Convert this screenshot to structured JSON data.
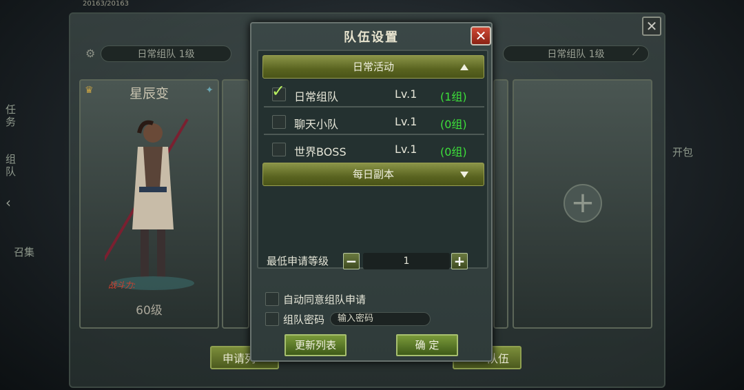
{
  "background": {
    "hp_text": "20163/20163",
    "left_chip": "日常组队 1级",
    "right_chip": "日常组队 1级",
    "hero_card": {
      "title": "星辰变",
      "level": "60级",
      "power_label": "战斗力:"
    },
    "side_left": [
      "任务",
      "组队",
      "召集"
    ],
    "side_right": [
      "开包"
    ],
    "bottom_left_btn": "申请列",
    "bottom_right_btn": "队伍",
    "icons": [
      "gear-icon",
      "crown-icon",
      "close-icon",
      "plus-icon",
      "brush-icon"
    ]
  },
  "dialog": {
    "title": "队伍设置",
    "close_icon": "close-icon",
    "categories": [
      {
        "label": "日常活动",
        "state": "expanded"
      },
      {
        "label": "每日副本",
        "state": "collapsed"
      }
    ],
    "rows": [
      {
        "name": "日常组队",
        "level": "Lv.1",
        "groups": "(1组)",
        "checked": true
      },
      {
        "name": "聊天小队",
        "level": "Lv.1",
        "groups": "(0组)",
        "checked": false
      },
      {
        "name": "世界BOSS",
        "level": "Lv.1",
        "groups": "(0组)",
        "checked": false
      }
    ],
    "min_level": {
      "label": "最低申请等级",
      "value": "1",
      "minus": "−",
      "plus": "+"
    },
    "auto_accept": {
      "label": "自动同意组队申请",
      "checked": false
    },
    "password": {
      "label": "组队密码",
      "placeholder": "输入密码",
      "checked": false
    },
    "buttons": {
      "refresh": "更新列表",
      "confirm": "确 定"
    }
  }
}
